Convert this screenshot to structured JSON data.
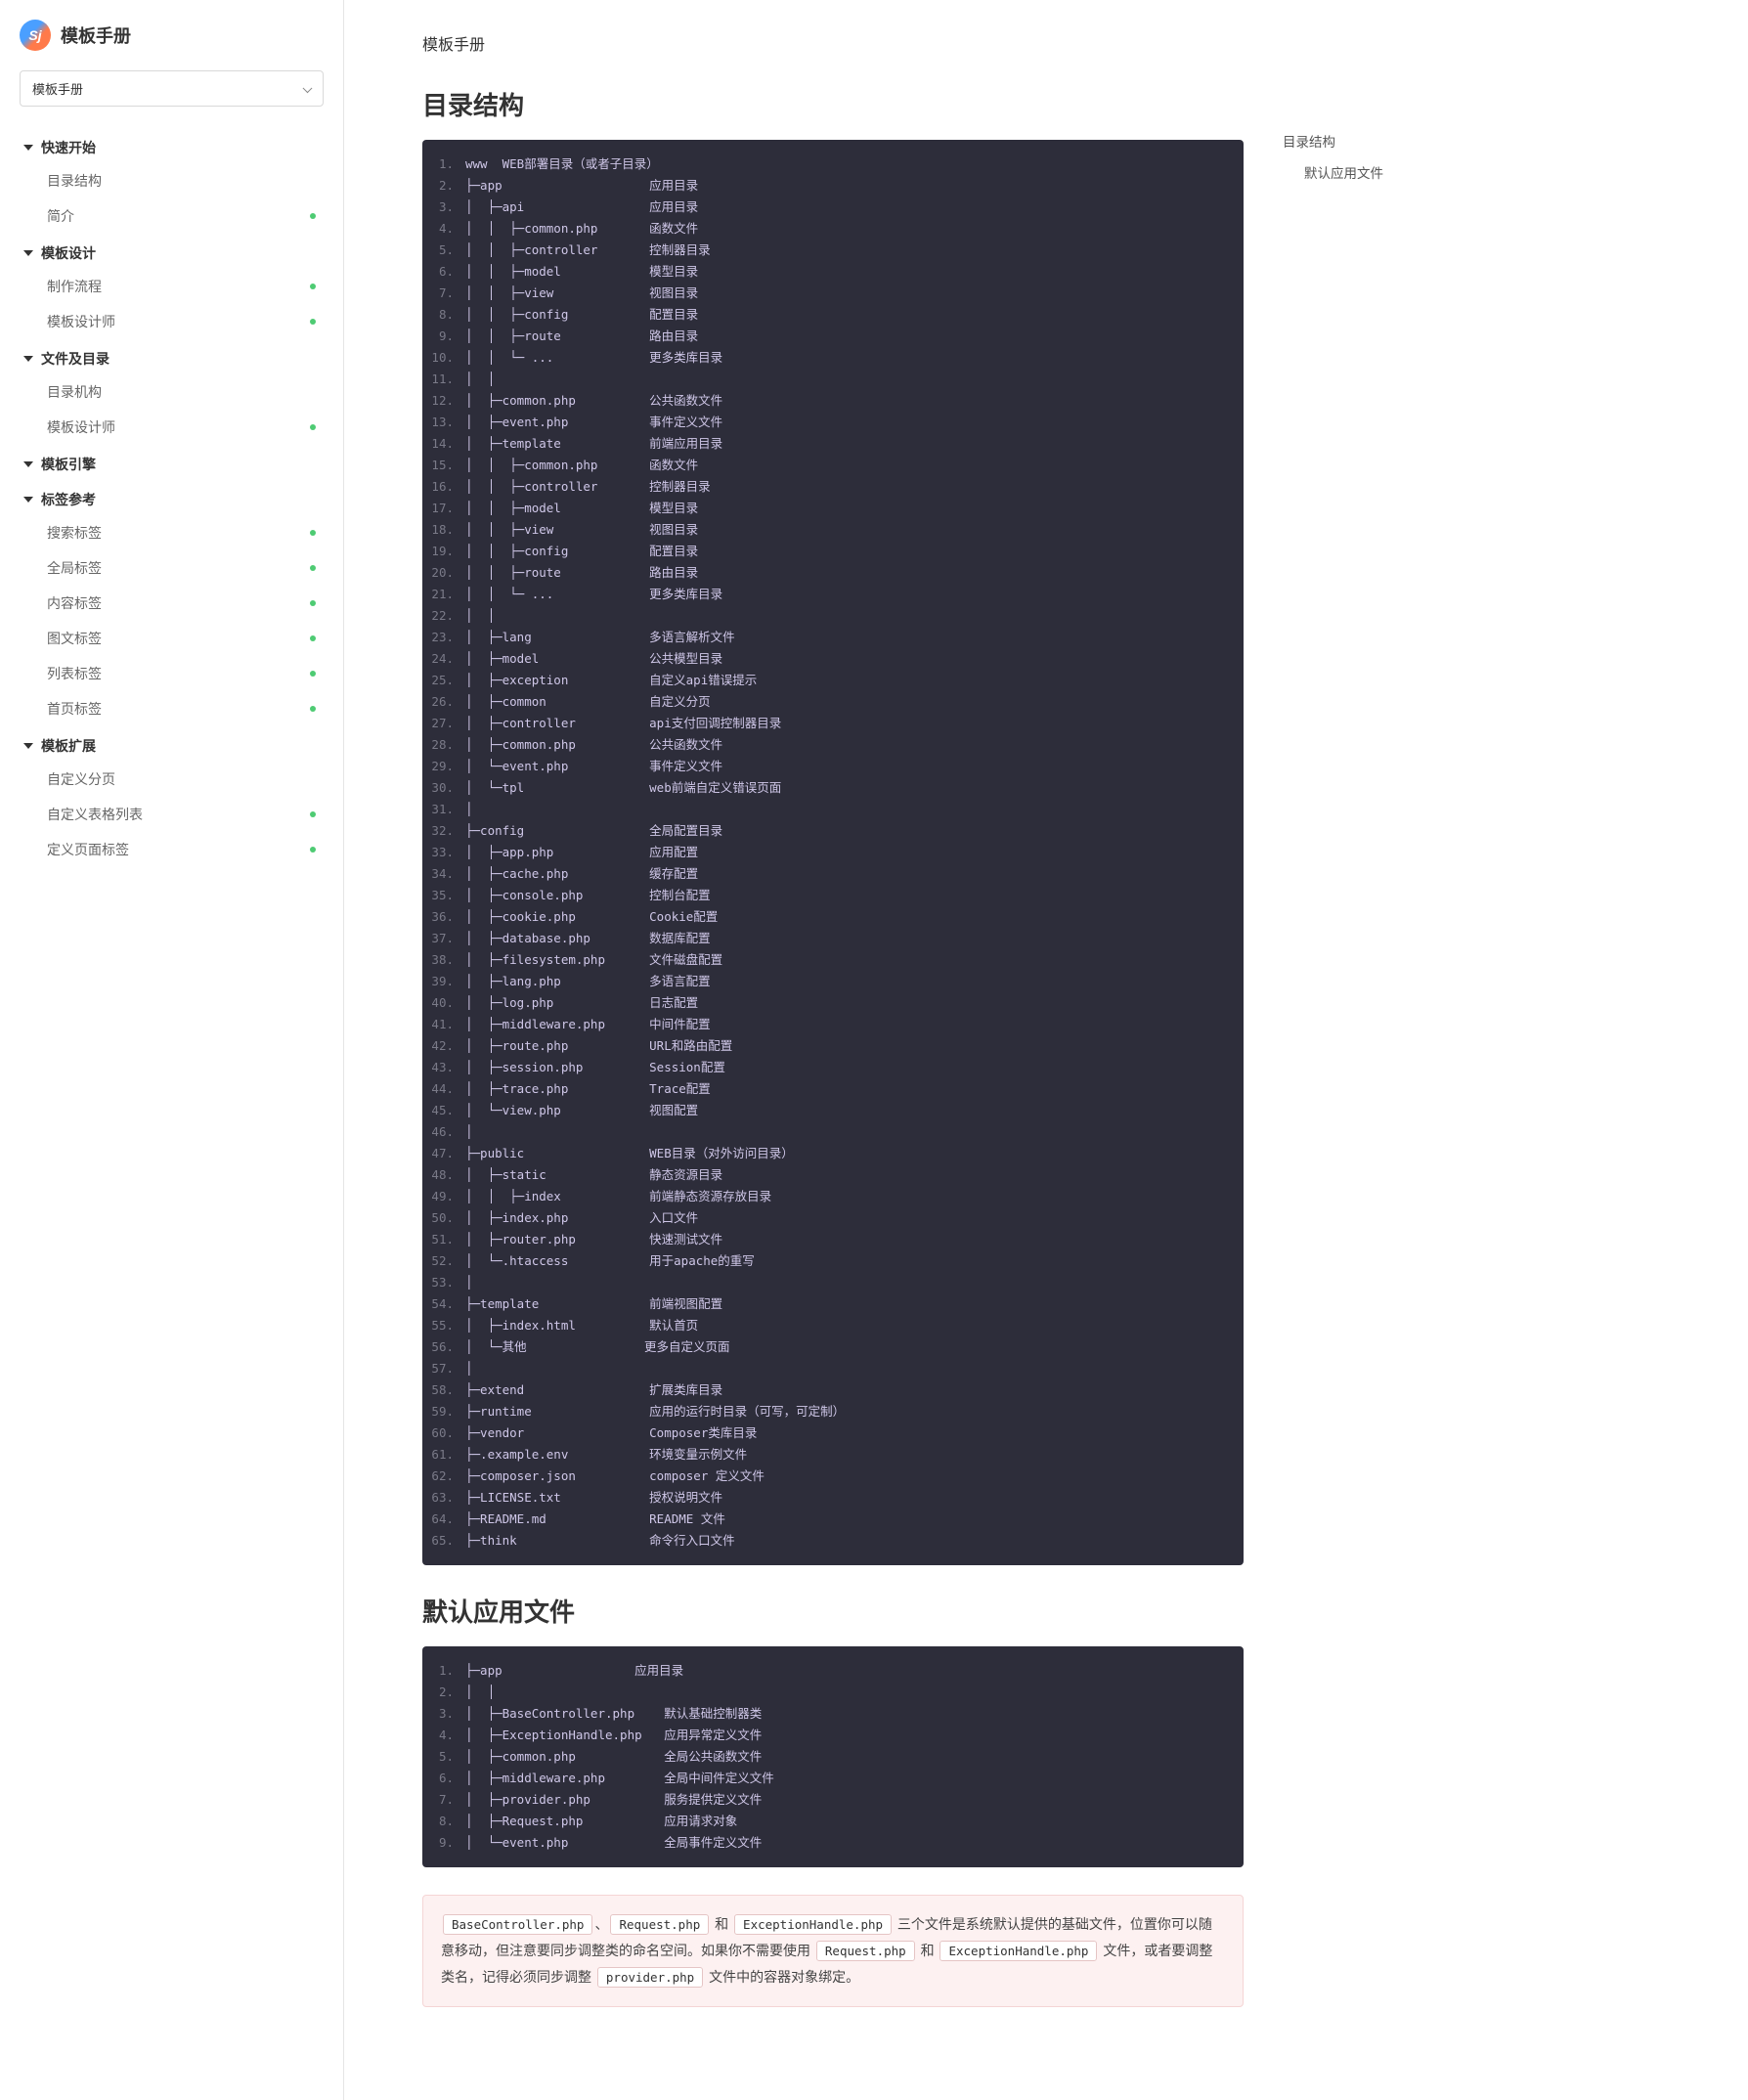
{
  "site": {
    "title": "模板手册",
    "selector": "模板手册"
  },
  "nav": [
    {
      "type": "section",
      "label": "快速开始"
    },
    {
      "type": "item",
      "label": "目录结构",
      "dot": false
    },
    {
      "type": "item",
      "label": "简介",
      "dot": true
    },
    {
      "type": "section",
      "label": "模板设计"
    },
    {
      "type": "item",
      "label": "制作流程",
      "dot": true
    },
    {
      "type": "item",
      "label": "模板设计师",
      "dot": true
    },
    {
      "type": "section",
      "label": "文件及目录"
    },
    {
      "type": "item",
      "label": "目录机构",
      "dot": false
    },
    {
      "type": "item",
      "label": "模板设计师",
      "dot": true
    },
    {
      "type": "section",
      "label": "模板引擎"
    },
    {
      "type": "section",
      "label": "标签参考"
    },
    {
      "type": "item",
      "label": "搜索标签",
      "dot": true
    },
    {
      "type": "item",
      "label": "全局标签",
      "dot": true
    },
    {
      "type": "item",
      "label": "内容标签",
      "dot": true
    },
    {
      "type": "item",
      "label": "图文标签",
      "dot": true
    },
    {
      "type": "item",
      "label": "列表标签",
      "dot": true
    },
    {
      "type": "item",
      "label": "首页标签",
      "dot": true
    },
    {
      "type": "section",
      "label": "模板扩展"
    },
    {
      "type": "item",
      "label": "自定义分页",
      "dot": false
    },
    {
      "type": "item",
      "label": "自定义表格列表",
      "dot": true
    },
    {
      "type": "item",
      "label": "定义页面标签",
      "dot": true
    }
  ],
  "breadcrumb": "模板手册",
  "toc": {
    "h1": "目录结构",
    "h2": "默认应用文件"
  },
  "sections": {
    "s1": "目录结构",
    "s2": "默认应用文件"
  },
  "code1": [
    "www  WEB部署目录（或者子目录）",
    "├─app                    应用目录",
    "│  ├─api                 应用目录",
    "│  │  ├─common.php       函数文件",
    "│  │  ├─controller       控制器目录",
    "│  │  ├─model            模型目录",
    "│  │  ├─view             视图目录",
    "│  │  ├─config           配置目录",
    "│  │  ├─route            路由目录",
    "│  │  └─ ...             更多类库目录",
    "│  │",
    "│  ├─common.php          公共函数文件",
    "│  ├─event.php           事件定义文件",
    "│  ├─template            前端应用目录",
    "│  │  ├─common.php       函数文件",
    "│  │  ├─controller       控制器目录",
    "│  │  ├─model            模型目录",
    "│  │  ├─view             视图目录",
    "│  │  ├─config           配置目录",
    "│  │  ├─route            路由目录",
    "│  │  └─ ...             更多类库目录",
    "│  │",
    "│  ├─lang                多语言解析文件",
    "│  ├─model               公共模型目录",
    "│  ├─exception           自定义api错误提示",
    "│  ├─common              自定义分页",
    "│  ├─controller          api支付回调控制器目录",
    "│  ├─common.php          公共函数文件",
    "│  └─event.php           事件定义文件",
    "│  └─tpl                 web前端自定义错误页面",
    "│",
    "├─config                 全局配置目录",
    "│  ├─app.php             应用配置",
    "│  ├─cache.php           缓存配置",
    "│  ├─console.php         控制台配置",
    "│  ├─cookie.php          Cookie配置",
    "│  ├─database.php        数据库配置",
    "│  ├─filesystem.php      文件磁盘配置",
    "│  ├─lang.php            多语言配置",
    "│  ├─log.php             日志配置",
    "│  ├─middleware.php      中间件配置",
    "│  ├─route.php           URL和路由配置",
    "│  ├─session.php         Session配置",
    "│  ├─trace.php           Trace配置",
    "│  └─view.php            视图配置",
    "│",
    "├─public                 WEB目录（对外访问目录）",
    "│  ├─static              静态资源目录",
    "│  │  ├─index            前端静态资源存放目录",
    "│  ├─index.php           入口文件",
    "│  ├─router.php          快速测试文件",
    "│  └─.htaccess           用于apache的重写",
    "│",
    "├─template               前端视图配置",
    "│  ├─index.html          默认首页",
    "│  └─其他                更多自定义页面",
    "│",
    "├─extend                 扩展类库目录",
    "├─runtime                应用的运行时目录（可写，可定制）",
    "├─vendor                 Composer类库目录",
    "├─.example.env           环境变量示例文件",
    "├─composer.json          composer 定义文件",
    "├─LICENSE.txt            授权说明文件",
    "├─README.md              README 文件",
    "├─think                  命令行入口文件"
  ],
  "code2": [
    "├─app                  应用目录",
    "│  │",
    "│  ├─BaseController.php    默认基础控制器类",
    "│  ├─ExceptionHandle.php   应用异常定义文件",
    "│  ├─common.php            全局公共函数文件",
    "│  ├─middleware.php        全局中间件定义文件",
    "│  ├─provider.php          服务提供定义文件",
    "│  ├─Request.php           应用请求对象",
    "│  └─event.php             全局事件定义文件"
  ],
  "note": {
    "c1": "BaseController.php",
    "t1": "、",
    "c2": "Request.php",
    "t2": " 和 ",
    "c3": "ExceptionHandle.php",
    "t3": " 三个文件是系统默认提供的基础文件，位置你可以随意移动，但注意要同步调整类的命名空间。如果你不需要使用 ",
    "c4": "Request.php",
    "t4": " 和 ",
    "c5": "ExceptionHandle.php",
    "t5": " 文件，或者要调整类名，记得必须同步调整 ",
    "c6": "provider.php",
    "t6": " 文件中的容器对象绑定。"
  }
}
